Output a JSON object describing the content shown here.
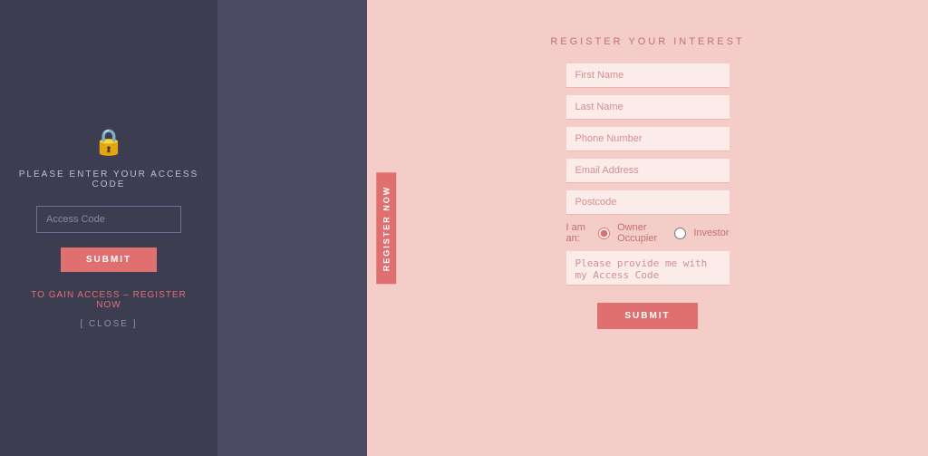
{
  "left": {
    "lock_icon": "🔒",
    "title": "PLEASE ENTER YOUR ACCESS CODE",
    "input_placeholder": "Access Code",
    "submit_label": "SUBMIT",
    "gain_access_text": "TO GAIN ACCESS –",
    "register_link": "REGISTER NOW",
    "close_label": "[ CLOSE ]"
  },
  "register_tab": {
    "label": "REGISTER NOW"
  },
  "right": {
    "title": "REGISTER YOUR INTEREST",
    "fields": [
      {
        "placeholder": "First Name",
        "type": "text"
      },
      {
        "placeholder": "Last Name",
        "type": "text"
      },
      {
        "placeholder": "Phone Number",
        "type": "text"
      },
      {
        "placeholder": "Email Address",
        "type": "email"
      },
      {
        "placeholder": "Postcode",
        "type": "text"
      }
    ],
    "radio_label": "I am an:",
    "radio_options": [
      "Owner Occupier",
      "Investor"
    ],
    "textarea_placeholder": "Please provide me with my Access Code",
    "submit_label": "SUBMIT"
  }
}
